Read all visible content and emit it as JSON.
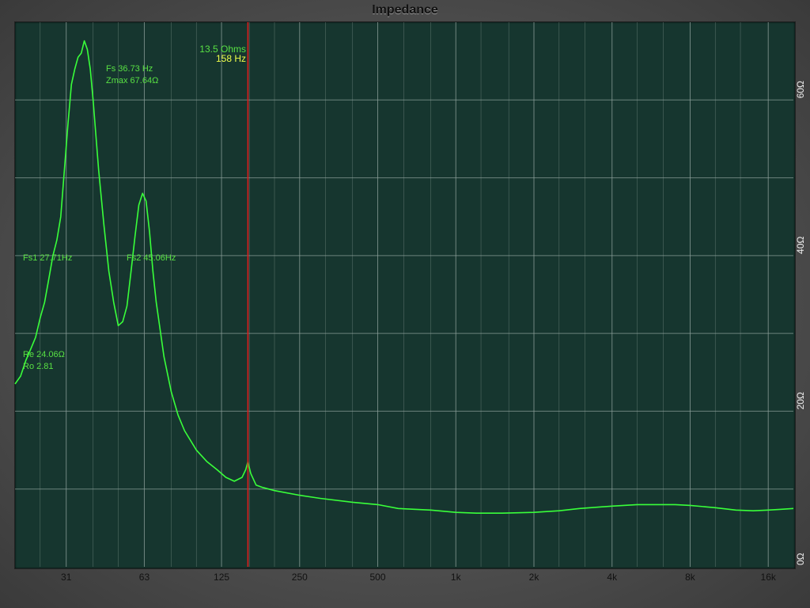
{
  "window": {
    "title": "Impedance"
  },
  "colors": {
    "plot_bg": "#16362f",
    "grid": "#8fa29c",
    "curve": "#39ff3a",
    "cursor": "#e01d1d",
    "annotation": "#58e043",
    "cursor_freq_label": "#f0ff4a"
  },
  "cursor": {
    "ohms_label": "13.5 Ohms",
    "hz_label": "158 Hz",
    "freq": 158
  },
  "annotations": {
    "fs": "Fs 36.73 Hz",
    "zmax": "Zmax 67.64Ω",
    "fs1": "Fs1 27.71Hz",
    "fs2": "Fs2 45.06Hz",
    "re": "Re 24.06Ω",
    "ro": "Ro 2.81"
  },
  "chart_data": {
    "type": "line",
    "title": "Impedance",
    "x_scale": "log",
    "xlim": [
      20,
      20000
    ],
    "ylim": [
      0,
      70
    ],
    "grid": true,
    "x_ticks": [
      {
        "value": 31.5,
        "label": "31"
      },
      {
        "value": 63,
        "label": "63"
      },
      {
        "value": 125,
        "label": "125"
      },
      {
        "value": 250,
        "label": "250"
      },
      {
        "value": 500,
        "label": "500"
      },
      {
        "value": 1000,
        "label": "1k"
      },
      {
        "value": 2000,
        "label": "2k"
      },
      {
        "value": 4000,
        "label": "4k"
      },
      {
        "value": 8000,
        "label": "8k"
      },
      {
        "value": 16000,
        "label": "16k"
      }
    ],
    "y_ticks": [
      {
        "value": 0,
        "label": "0Ω"
      },
      {
        "value": 20,
        "label": "20Ω"
      },
      {
        "value": 40,
        "label": "40Ω"
      },
      {
        "value": 60,
        "label": "60Ω"
      }
    ],
    "x_minor_grid": [
      25,
      31.5,
      40,
      50,
      63,
      80,
      100,
      125,
      160,
      200,
      250,
      315,
      400,
      500,
      630,
      800,
      1000,
      1250,
      1600,
      2000,
      2500,
      3150,
      4000,
      5000,
      6300,
      8000,
      10000,
      12500,
      16000
    ],
    "y_grid": [
      10,
      20,
      30,
      40,
      50,
      60
    ],
    "series": [
      {
        "x": [
          20,
          21,
          22,
          23,
          24,
          25,
          26,
          27,
          28,
          29,
          30,
          31,
          32,
          33,
          34,
          35,
          36,
          37,
          38,
          39,
          40,
          42,
          44,
          46,
          48,
          50,
          52,
          54,
          56,
          58,
          60,
          62,
          64,
          66,
          68,
          70,
          75,
          80,
          85,
          90,
          100,
          110,
          120,
          130,
          140,
          150,
          155,
          158,
          162,
          170,
          180,
          200,
          250,
          300,
          400,
          500,
          600,
          800,
          1000,
          1200,
          1500,
          2000,
          2500,
          3000,
          4000,
          5000,
          6000,
          7000,
          8000,
          10000,
          12000,
          14000,
          16000,
          18000,
          20000
        ],
        "y": [
          23.5,
          24.5,
          26.5,
          28.0,
          29.5,
          32.0,
          34.0,
          37.0,
          40.0,
          42.0,
          45.0,
          51.0,
          57.0,
          62.0,
          64.0,
          65.5,
          66.0,
          67.6,
          66.5,
          64.0,
          60.0,
          51.0,
          44.0,
          38.0,
          34.0,
          31.0,
          31.5,
          33.5,
          38.0,
          42.5,
          46.5,
          48.0,
          47.0,
          43.0,
          38.0,
          34.0,
          27.0,
          22.5,
          19.5,
          17.5,
          15.0,
          13.5,
          12.5,
          11.5,
          11.0,
          11.5,
          12.5,
          13.5,
          12.0,
          10.5,
          10.2,
          9.8,
          9.2,
          8.8,
          8.3,
          8.0,
          7.5,
          7.3,
          7.0,
          6.9,
          6.9,
          7.0,
          7.2,
          7.5,
          7.8,
          8.0,
          8.0,
          8.0,
          7.9,
          7.6,
          7.3,
          7.2,
          7.3,
          7.4,
          7.5
        ]
      }
    ]
  }
}
